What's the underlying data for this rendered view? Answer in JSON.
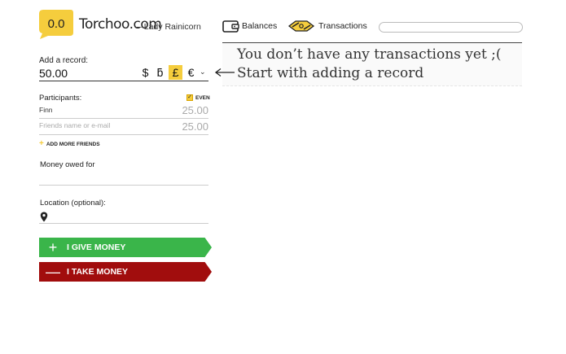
{
  "header": {
    "logo_mark": "0.0",
    "logo_text": "Torchoo.com",
    "user_name": "– Lady Rainicorn",
    "nav": [
      {
        "label": "Balances",
        "icon": "wallet-icon"
      },
      {
        "label": "Transactions",
        "icon": "transactions-icon"
      }
    ],
    "search": {
      "value": "",
      "placeholder": ""
    }
  },
  "form": {
    "add_record_label": "Add a record:",
    "amount_value": "50.00",
    "currencies": [
      "$",
      "ƃ",
      "£",
      "€"
    ],
    "selected_currency": "£",
    "currency_caret": "⌄",
    "participants_label": "Participants:",
    "even_label": "EVEN",
    "even_checked": true,
    "participants": [
      {
        "name": "Finn",
        "amount": "25.00"
      }
    ],
    "new_participant": {
      "placeholder": "Friends name or e-mail",
      "amount": "25.00"
    },
    "add_friends_label": "ADD MORE FRIENDS",
    "owed_for_label": "Money owed for",
    "owed_for_value": "",
    "location_label": "Location (optional):",
    "location_value": "",
    "give_button": {
      "label": "I GIVE MONEY",
      "icon": "plus-icon",
      "color": "#3ab54a"
    },
    "take_button": {
      "label": "I TAKE MONEY",
      "icon": "minus-icon",
      "color": "#a10d0d"
    }
  },
  "empty_state": {
    "line1": "You don’t have any transactions yet ;(",
    "line2": "Start with adding a record"
  },
  "colors": {
    "accent": "#f5cd3d",
    "give": "#3ab54a",
    "take": "#a10d0d"
  }
}
